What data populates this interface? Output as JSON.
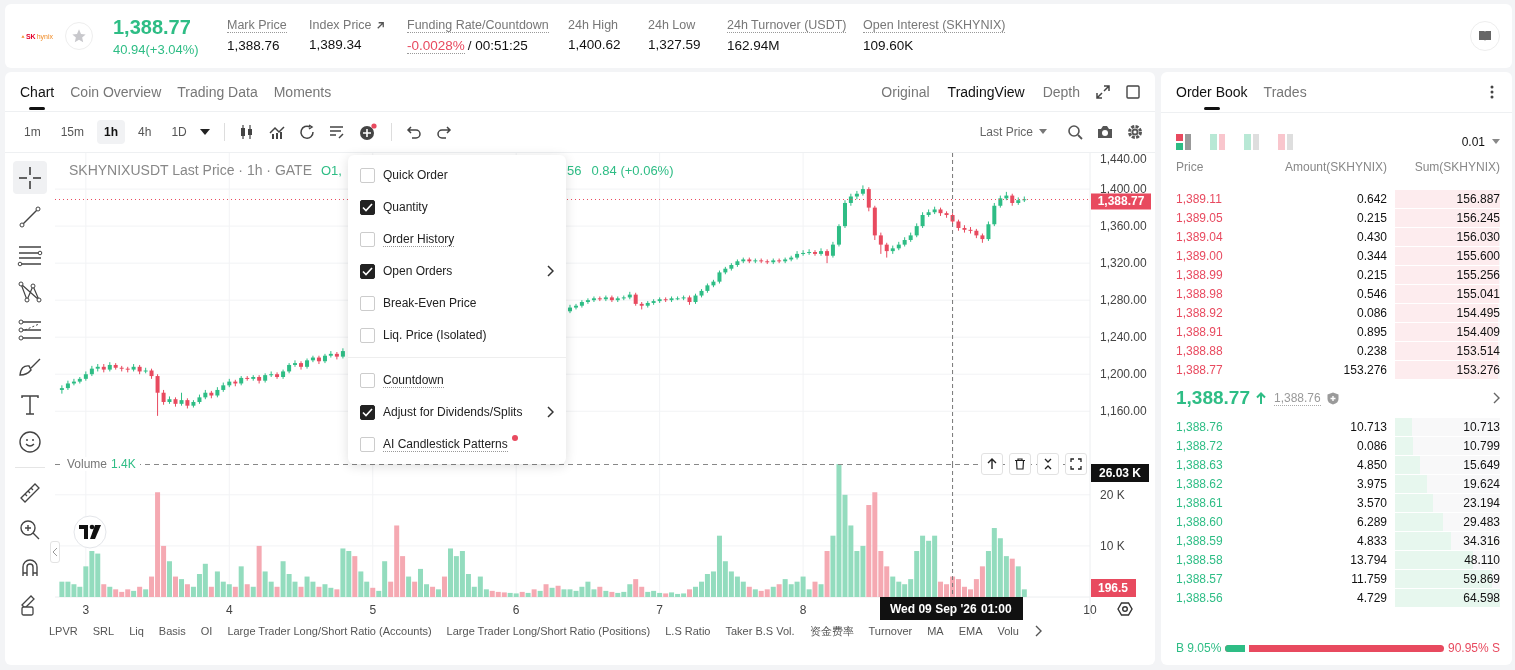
{
  "header": {
    "logo": [
      "SK",
      "hynix"
    ],
    "price": "1,388.77",
    "change": "40.94(+3.04%)",
    "stats": [
      {
        "kind": "plain",
        "label": "Mark Price",
        "value": "1,388.76",
        "underlined": true,
        "link": false
      },
      {
        "kind": "plain",
        "label": "Index Price",
        "value": "1,389.34",
        "underlined": false,
        "link": true
      },
      {
        "kind": "funding",
        "label": "Funding Rate/Countdown",
        "value": "-0.0028%",
        "extra": "/ 00:51:25",
        "underlined": true,
        "link": false
      },
      {
        "kind": "plain",
        "label": "24h High",
        "value": "1,400.62",
        "underlined": false,
        "link": false
      },
      {
        "kind": "plain",
        "label": "24h Low",
        "value": "1,327.59",
        "underlined": false,
        "link": false
      },
      {
        "kind": "plain",
        "label": "24h Turnover (USDT)",
        "value": "162.94M",
        "underlined": true,
        "link": false
      },
      {
        "kind": "plain",
        "label": "Open Interest (SKHYNIX)",
        "value": "109.60K",
        "underlined": true,
        "link": false
      }
    ]
  },
  "chart_panel": {
    "tabs": [
      {
        "label": "Chart",
        "selected": true
      },
      {
        "label": "Coin Overview",
        "selected": false
      },
      {
        "label": "Trading Data",
        "selected": false
      },
      {
        "label": "Moments",
        "selected": false
      }
    ],
    "views": [
      {
        "label": "Original",
        "selected": false
      },
      {
        "label": "TradingView",
        "selected": true
      },
      {
        "label": "Depth",
        "selected": false
      }
    ],
    "intervals": [
      {
        "label": "1m",
        "selected": false
      },
      {
        "label": "15m",
        "selected": false
      },
      {
        "label": "1h",
        "selected": true
      },
      {
        "label": "4h",
        "selected": false
      },
      {
        "label": "1D",
        "selected": false
      }
    ],
    "price_type": "Last Price",
    "legend": {
      "title": "SKHYNIXUSDT Last Price · 1h · GATE",
      "open": "O1,",
      "close_tail": "56",
      "change": "0.84 (+0.06%)"
    },
    "price_top_tick": "1,440.00",
    "price_chart": {
      "chart_data": {
        "type": "candlestick",
        "ylim": [
          1103,
          1439
        ],
        "xlim": [
          2.785,
          10
        ],
        "grid": true,
        "ref_lines": [
          {
            "axis": "y",
            "value": 1388.77
          },
          {
            "axis": "x",
            "value": 9.042
          }
        ],
        "x": [
          2.833,
          2.875,
          2.917,
          2.958,
          3,
          3.042,
          3.083,
          3.125,
          3.167,
          3.208,
          3.25,
          3.292,
          3.333,
          3.375,
          3.417,
          3.458,
          3.5,
          3.542,
          3.583,
          3.625,
          3.667,
          3.708,
          3.75,
          3.792,
          3.833,
          3.875,
          3.917,
          3.958,
          4,
          4.042,
          4.083,
          4.125,
          4.167,
          4.208,
          4.25,
          4.292,
          4.333,
          4.375,
          4.417,
          4.458,
          4.5,
          4.542,
          4.583,
          4.625,
          4.667,
          4.708,
          4.75,
          4.792,
          null,
          null,
          null,
          null,
          null,
          null,
          null,
          null,
          null,
          null,
          null,
          null,
          null,
          null,
          null,
          null,
          null,
          null,
          null,
          null,
          null,
          null,
          null,
          null,
          null,
          null,
          null,
          null,
          null,
          null,
          null,
          null,
          null,
          null,
          null,
          null,
          null,
          6.375,
          6.417,
          6.458,
          6.5,
          6.542,
          6.583,
          6.625,
          6.667,
          6.708,
          6.75,
          6.792,
          6.833,
          6.875,
          6.917,
          6.958,
          7,
          7.042,
          7.083,
          7.125,
          7.167,
          7.208,
          7.25,
          7.292,
          7.333,
          7.375,
          7.417,
          7.458,
          7.5,
          7.542,
          7.583,
          7.625,
          7.667,
          7.708,
          7.75,
          7.792,
          7.833,
          7.875,
          7.917,
          7.958,
          8,
          8.042,
          8.083,
          8.125,
          8.167,
          8.208,
          8.25,
          8.292,
          8.333,
          8.375,
          8.417,
          8.458,
          8.5,
          8.542,
          8.583,
          8.625,
          8.667,
          8.708,
          8.75,
          8.792,
          8.833,
          8.875,
          8.917,
          8.958,
          9,
          9.042,
          9.083,
          9.125,
          9.167,
          9.208,
          9.25,
          9.292,
          9.333,
          9.375,
          9.417,
          9.458,
          9.5,
          9.542
        ],
        "yticks": [
          {
            "value": 1400,
            "label": "1,400.00"
          },
          {
            "value": 1360,
            "label": "1,360.00"
          },
          {
            "value": 1320,
            "label": "1,320.00"
          },
          {
            "value": 1280,
            "label": "1,280.00"
          },
          {
            "value": 1240,
            "label": "1,240.00"
          },
          {
            "value": 1200,
            "label": "1,200.00"
          },
          {
            "value": 1160,
            "label": "1,160.00"
          }
        ],
        "ohlc": [
          [
            1183,
            1188,
            1179,
            1185
          ],
          [
            1185,
            1193,
            1183,
            1190
          ],
          [
            1190,
            1195,
            1188,
            1192
          ],
          [
            1192,
            1197,
            1190,
            1195
          ],
          [
            1195,
            1203,
            1193,
            1200
          ],
          [
            1200,
            1209,
            1198,
            1206
          ],
          [
            1206,
            1211,
            1203,
            1208
          ],
          [
            1208,
            1211,
            1202,
            1205
          ],
          [
            1205,
            1213,
            1203,
            1210
          ],
          [
            1210,
            1212,
            1205,
            1207
          ],
          [
            1207,
            1209,
            1203,
            1206
          ],
          [
            1206,
            1208,
            1202,
            1205
          ],
          [
            1205,
            1211,
            1203,
            1208
          ],
          [
            1208,
            1210,
            1200,
            1203
          ],
          [
            1203,
            1207,
            1201,
            1204
          ],
          [
            1204,
            1206,
            1195,
            1198
          ],
          [
            1198,
            1200,
            1155,
            1180
          ],
          [
            1180,
            1183,
            1167,
            1170
          ],
          [
            1170,
            1176,
            1168,
            1173
          ],
          [
            1173,
            1175,
            1165,
            1168
          ],
          [
            1168,
            1180,
            1166,
            1172
          ],
          [
            1172,
            1174,
            1163,
            1166
          ],
          [
            1166,
            1172,
            1164,
            1170
          ],
          [
            1170,
            1178,
            1168,
            1175
          ],
          [
            1175,
            1183,
            1173,
            1180
          ],
          [
            1180,
            1182,
            1174,
            1177
          ],
          [
            1177,
            1186,
            1175,
            1183
          ],
          [
            1183,
            1191,
            1181,
            1188
          ],
          [
            1188,
            1195,
            1186,
            1192
          ],
          [
            1192,
            1194,
            1187,
            1190
          ],
          [
            1190,
            1198,
            1188,
            1196
          ],
          [
            1196,
            1198,
            1193,
            1195
          ],
          [
            1195,
            1199,
            1193,
            1197
          ],
          [
            1197,
            1199,
            1190,
            1193
          ],
          [
            1193,
            1201,
            1191,
            1199
          ],
          [
            1199,
            1203,
            1197,
            1200
          ],
          [
            1200,
            1202,
            1195,
            1197
          ],
          [
            1197,
            1205,
            1195,
            1203
          ],
          [
            1203,
            1212,
            1201,
            1210
          ],
          [
            1210,
            1215,
            1208,
            1212
          ],
          [
            1212,
            1214,
            1205,
            1208
          ],
          [
            1208,
            1217,
            1206,
            1215
          ],
          [
            1215,
            1220,
            1213,
            1218
          ],
          [
            1218,
            1220,
            1211,
            1214
          ],
          [
            1214,
            1222,
            1212,
            1220
          ],
          [
            1220,
            1225,
            1218,
            1222
          ],
          [
            1222,
            1224,
            1216,
            1219
          ],
          [
            1219,
            1228,
            1217,
            1225
          ],
          null,
          null,
          null,
          null,
          null,
          null,
          null,
          null,
          null,
          null,
          null,
          null,
          null,
          null,
          null,
          null,
          null,
          null,
          null,
          null,
          null,
          null,
          null,
          null,
          null,
          null,
          null,
          null,
          null,
          null,
          null,
          null,
          null,
          null,
          null,
          null,
          null,
          [
            1268,
            1275,
            1266,
            1272
          ],
          [
            1272,
            1276,
            1270,
            1274
          ],
          [
            1274,
            1280,
            1272,
            1278
          ],
          [
            1278,
            1282,
            1276,
            1280
          ],
          [
            1280,
            1284,
            1278,
            1282
          ],
          [
            1282,
            1284,
            1279,
            1281
          ],
          [
            1281,
            1285,
            1279,
            1283
          ],
          [
            1283,
            1285,
            1278,
            1280
          ],
          [
            1280,
            1284,
            1278,
            1282
          ],
          [
            1282,
            1285,
            1280,
            1283
          ],
          [
            1283,
            1289,
            1281,
            1286
          ],
          [
            1286,
            1288,
            1274,
            1276
          ],
          [
            1276,
            1278,
            1270,
            1274
          ],
          [
            1274,
            1279,
            1272,
            1277
          ],
          [
            1277,
            1281,
            1275,
            1279
          ],
          [
            1279,
            1283,
            1277,
            1281
          ],
          [
            1281,
            1283,
            1278,
            1280
          ],
          [
            1280,
            1284,
            1278,
            1282
          ],
          [
            1282,
            1284,
            1280,
            1282
          ],
          [
            1282,
            1285,
            1280,
            1283
          ],
          [
            1283,
            1285,
            1275,
            1278
          ],
          [
            1278,
            1287,
            1276,
            1285
          ],
          [
            1285,
            1292,
            1283,
            1290
          ],
          [
            1290,
            1298,
            1288,
            1296
          ],
          [
            1296,
            1302,
            1294,
            1300
          ],
          [
            1300,
            1312,
            1298,
            1310
          ],
          [
            1310,
            1316,
            1308,
            1314
          ],
          [
            1314,
            1320,
            1312,
            1318
          ],
          [
            1318,
            1324,
            1316,
            1322
          ],
          [
            1322,
            1326,
            1320,
            1324
          ],
          [
            1324,
            1326,
            1320,
            1322
          ],
          [
            1322,
            1325,
            1320,
            1323
          ],
          [
            1323,
            1325,
            1320,
            1322
          ],
          [
            1322,
            1324,
            1319,
            1321
          ],
          [
            1321,
            1325,
            1319,
            1323
          ],
          [
            1323,
            1325,
            1320,
            1322
          ],
          [
            1322,
            1326,
            1320,
            1324
          ],
          [
            1324,
            1328,
            1322,
            1326
          ],
          [
            1326,
            1333,
            1324,
            1330
          ],
          [
            1330,
            1334,
            1328,
            1331
          ],
          [
            1331,
            1335,
            1329,
            1332
          ],
          [
            1332,
            1334,
            1328,
            1330
          ],
          [
            1330,
            1336,
            1328,
            1333
          ],
          [
            1333,
            1335,
            1320,
            1328
          ],
          [
            1328,
            1343,
            1326,
            1340
          ],
          [
            1340,
            1362,
            1338,
            1360
          ],
          [
            1360,
            1388,
            1358,
            1385
          ],
          [
            1385,
            1395,
            1382,
            1392
          ],
          [
            1392,
            1398,
            1389,
            1395
          ],
          [
            1395,
            1404,
            1393,
            1400
          ],
          [
            1400,
            1402,
            1376,
            1380
          ],
          [
            1380,
            1382,
            1345,
            1350
          ],
          [
            1350,
            1353,
            1330,
            1340
          ],
          [
            1340,
            1342,
            1326,
            1333
          ],
          [
            1333,
            1339,
            1330,
            1336
          ],
          [
            1336,
            1343,
            1334,
            1340
          ],
          [
            1340,
            1348,
            1338,
            1345
          ],
          [
            1345,
            1353,
            1343,
            1350
          ],
          [
            1350,
            1363,
            1348,
            1360
          ],
          [
            1360,
            1375,
            1358,
            1372
          ],
          [
            1372,
            1378,
            1370,
            1375
          ],
          [
            1375,
            1381,
            1373,
            1378
          ],
          [
            1378,
            1380,
            1371,
            1374
          ],
          [
            1374,
            1376,
            1369,
            1372
          ],
          [
            1372,
            1374,
            1362,
            1365
          ],
          [
            1365,
            1367,
            1355,
            1358
          ],
          [
            1358,
            1361,
            1353,
            1356
          ],
          [
            1356,
            1359,
            1352,
            1355
          ],
          [
            1355,
            1357,
            1347,
            1350
          ],
          [
            1350,
            1352,
            1342,
            1346
          ],
          [
            1346,
            1365,
            1344,
            1362
          ],
          [
            1362,
            1385,
            1360,
            1382
          ],
          [
            1382,
            1393,
            1380,
            1390
          ],
          [
            1390,
            1397,
            1388,
            1393
          ],
          [
            1393,
            1395,
            1382,
            1385
          ],
          [
            1385,
            1391,
            1383,
            1388
          ],
          [
            1388,
            1392,
            1386,
            1389
          ]
        ]
      }
    },
    "last_price_badge": "1,388.77",
    "volume": {
      "value": "1.4K",
      "rising": [
        true,
        true,
        true,
        true,
        true,
        true,
        true,
        false,
        true,
        false,
        false,
        false,
        true,
        false,
        true,
        false,
        false,
        false,
        true,
        false,
        true,
        false,
        true,
        true,
        true,
        false,
        true,
        true,
        true,
        false,
        true,
        false,
        true,
        false,
        true,
        true,
        false,
        true,
        true,
        true,
        false,
        true,
        true,
        false,
        true,
        true,
        false,
        true,
        true,
        false,
        true,
        true,
        false,
        true,
        true,
        false,
        false,
        false,
        true,
        false,
        true,
        true,
        false,
        true,
        false,
        true,
        true,
        true,
        true,
        true,
        true,
        true,
        false,
        false,
        false,
        true,
        true,
        false,
        true,
        false,
        true,
        false,
        true,
        false,
        true,
        true,
        true,
        true,
        true,
        true,
        false,
        true,
        false,
        true,
        true,
        true,
        false,
        false,
        true,
        true,
        true,
        false,
        true,
        true,
        true,
        false,
        true,
        true,
        true,
        true,
        true,
        true,
        true,
        true,
        true,
        false,
        true,
        false,
        false,
        true,
        false,
        true,
        true,
        true,
        true,
        true,
        false,
        true,
        false,
        true,
        true,
        true,
        true,
        true,
        true,
        false,
        false,
        false,
        false,
        true,
        true,
        true,
        true,
        true,
        true,
        true,
        true,
        false,
        false,
        false,
        false,
        false,
        false,
        false,
        false,
        true,
        true,
        true,
        true,
        false,
        true,
        true
      ],
      "cursor_badge": "26.03 K",
      "last_badge": "196.5",
      "chart_data": {
        "type": "bar",
        "ylim": [
          0,
          26030
        ],
        "xlim": [
          2.785,
          10
        ],
        "grid": true,
        "ref_lines": [
          {
            "axis": "x",
            "value": 9.042
          },
          {
            "axis": "y",
            "value": 26030
          }
        ],
        "x": [
          2.833,
          2.875,
          2.917,
          2.958,
          3,
          3.042,
          3.083,
          3.125,
          3.167,
          3.208,
          3.25,
          3.292,
          3.333,
          3.375,
          3.417,
          3.458,
          3.5,
          3.542,
          3.583,
          3.625,
          3.667,
          3.708,
          3.75,
          3.792,
          3.833,
          3.875,
          3.917,
          3.958,
          4,
          4.042,
          4.083,
          4.125,
          4.167,
          4.208,
          4.25,
          4.292,
          4.333,
          4.375,
          4.417,
          4.458,
          4.5,
          4.542,
          4.583,
          4.625,
          4.667,
          4.708,
          4.75,
          4.792,
          4.833,
          4.875,
          4.917,
          4.958,
          5,
          5.042,
          5.083,
          5.125,
          5.167,
          5.208,
          5.25,
          5.292,
          5.333,
          5.375,
          5.417,
          5.458,
          5.5,
          5.542,
          5.583,
          5.625,
          5.667,
          5.708,
          5.75,
          5.792,
          5.833,
          5.875,
          5.917,
          5.958,
          6,
          6.042,
          6.083,
          6.125,
          6.167,
          6.208,
          6.25,
          6.292,
          6.333,
          6.375,
          6.417,
          6.458,
          6.5,
          6.542,
          6.583,
          6.625,
          6.667,
          6.708,
          6.75,
          6.792,
          6.833,
          6.875,
          6.917,
          6.958,
          7,
          7.042,
          7.083,
          7.125,
          7.167,
          7.208,
          7.25,
          7.292,
          7.333,
          7.375,
          7.417,
          7.458,
          7.5,
          7.542,
          7.583,
          7.625,
          7.667,
          7.708,
          7.75,
          7.792,
          7.833,
          7.875,
          7.917,
          7.958,
          8,
          8.042,
          8.083,
          8.125,
          8.167,
          8.208,
          8.25,
          8.292,
          8.333,
          8.375,
          8.417,
          8.458,
          8.5,
          8.542,
          8.583,
          8.625,
          8.667,
          8.708,
          8.75,
          8.792,
          8.833,
          8.875,
          8.917,
          8.958,
          9,
          9.042,
          9.083,
          9.125,
          9.167,
          9.208,
          9.25,
          9.292,
          9.333,
          9.375,
          9.417,
          9.458,
          9.5,
          9.542
        ],
        "xticks": [
          {
            "value": 3,
            "label": "3"
          },
          {
            "value": 4,
            "label": "4"
          },
          {
            "value": 5,
            "label": "5"
          },
          {
            "value": 6,
            "label": "6"
          },
          {
            "value": 7,
            "label": "7"
          },
          {
            "value": 8,
            "label": "8"
          },
          {
            "value": 10,
            "label": "10"
          }
        ],
        "yticks": [
          {
            "value": 20000,
            "label": "20 K"
          },
          {
            "value": 10000,
            "label": "10 K"
          }
        ],
        "series": [
          {
            "name": "Volume",
            "values": [
              3000,
              3000,
              2500,
              2000,
              6000,
              9000,
              8500,
              2500,
              2000,
              1500,
              1000,
              1500,
              1200,
              2000,
              1500,
              4000,
              20500,
              10000,
              7000,
              4000,
              3500,
              2500,
              2000,
              4500,
              6500,
              2000,
              5000,
              3000,
              2500,
              2000,
              6000,
              2500,
              2000,
              10000,
              5000,
              3000,
              2000,
              7000,
              4500,
              3000,
              2000,
              4000,
              3000,
              2000,
              2500,
              1800,
              1500,
              9500,
              9000,
              8000,
              5000,
              3000,
              1800,
              1200,
              7000,
              3000,
              14000,
              8000,
              4000,
              3000,
              5500,
              2500,
              2000,
              1500,
              4000,
              9500,
              8000,
              9000,
              4500,
              2000,
              4000,
              1500,
              1200,
              1000,
              900,
              800,
              700,
              1000,
              800,
              1500,
              1200,
              2500,
              1800,
              2200,
              1500,
              1500,
              1200,
              2000,
              3000,
              1500,
              2000,
              1200,
              1000,
              800,
              1000,
              2500,
              3500,
              2000,
              1000,
              1200,
              800,
              700,
              900,
              600,
              700,
              1500,
              2000,
              3000,
              4500,
              5000,
              12000,
              7000,
              5000,
              4000,
              3000,
              2000,
              1500,
              1200,
              1500,
              2000,
              2500,
              3500,
              2500,
              3000,
              4000,
              1500,
              3000,
              2500,
              9000,
              12000,
              26030,
              20000,
              14000,
              9000,
              10000,
              18000,
              20500,
              9000,
              6000,
              4000,
              3000,
              2500,
              3500,
              9000,
              12000,
              11000,
              12000,
              3000,
              2500,
              4000,
              3500,
              2000,
              1500,
              3500,
              6000,
              9000,
              13500,
              11500,
              8000,
              7500,
              6000,
              1500
            ]
          }
        ]
      }
    },
    "crosshair": {
      "date": "Wed 09 Sep '26",
      "time": "01:00"
    },
    "indicators": [
      "LPVR",
      "SRL",
      "Liq",
      "Basis",
      "OI",
      "Large Trader Long/Short Ratio (Accounts)",
      "Large Trader Long/Short Ratio (Positions)",
      "L.S Ratio",
      "Taker B.S Vol.",
      "资金费率",
      "Turnover",
      "MA",
      "EMA",
      "Volu"
    ],
    "menu": {
      "groups": [
        [
          {
            "label": "Quick Order",
            "checked": false,
            "tooltip": false,
            "submenu": false,
            "new": false
          },
          {
            "label": "Quantity",
            "checked": true,
            "tooltip": false,
            "submenu": false,
            "new": false
          },
          {
            "label": "Order History",
            "checked": false,
            "tooltip": true,
            "submenu": false,
            "new": false
          },
          {
            "label": "Open Orders",
            "checked": true,
            "tooltip": false,
            "submenu": true,
            "new": false
          },
          {
            "label": "Break-Even Price",
            "checked": false,
            "tooltip": false,
            "submenu": false,
            "new": false
          },
          {
            "label": "Liq. Price (Isolated)",
            "checked": false,
            "tooltip": false,
            "submenu": false,
            "new": false
          }
        ],
        [
          {
            "label": "Countdown",
            "checked": false,
            "tooltip": true,
            "submenu": false,
            "new": false
          },
          {
            "label": "Adjust for Dividends/Splits",
            "checked": true,
            "tooltip": false,
            "submenu": true,
            "new": false
          },
          {
            "label": "AI Candlestick Patterns",
            "checked": false,
            "tooltip": true,
            "submenu": false,
            "new": true
          }
        ]
      ]
    }
  },
  "order_book": {
    "tabs": [
      {
        "label": "Order Book",
        "selected": true
      },
      {
        "label": "Trades",
        "selected": false
      }
    ],
    "layouts": [
      {
        "kind": "both",
        "selected": true
      },
      {
        "kind": "bids",
        "selected": false
      },
      {
        "kind": "bids-only",
        "selected": false
      },
      {
        "kind": "asks",
        "selected": false
      }
    ],
    "precision": "0.01",
    "columns": [
      "Price",
      "Amount(SKHYNIX)",
      "Sum(SKHYNIX)"
    ],
    "asks": [
      {
        "price": "1,389.11",
        "amount": "0.642",
        "sum": "156.887",
        "level": 1
      },
      {
        "price": "1,389.05",
        "amount": "0.215",
        "sum": "156.245",
        "level": 0.996
      },
      {
        "price": "1,389.04",
        "amount": "0.430",
        "sum": "156.030",
        "level": 0.995
      },
      {
        "price": "1,389.00",
        "amount": "0.344",
        "sum": "155.600",
        "level": 0.992
      },
      {
        "price": "1,388.99",
        "amount": "0.215",
        "sum": "155.256",
        "level": 0.99
      },
      {
        "price": "1,388.98",
        "amount": "0.546",
        "sum": "155.041",
        "level": 0.988
      },
      {
        "price": "1,388.92",
        "amount": "0.086",
        "sum": "154.495",
        "level": 0.985
      },
      {
        "price": "1,388.91",
        "amount": "0.895",
        "sum": "154.409",
        "level": 0.984
      },
      {
        "price": "1,388.88",
        "amount": "0.238",
        "sum": "153.514",
        "level": 0.979
      },
      {
        "price": "1,388.77",
        "amount": "153.276",
        "sum": "153.276",
        "level": 0.977
      }
    ],
    "last_price": "1,388.77",
    "mark_price": "1,388.76",
    "bids": [
      {
        "price": "1,388.76",
        "amount": "10.713",
        "sum": "10.713",
        "level": 0.166
      },
      {
        "price": "1,388.72",
        "amount": "0.086",
        "sum": "10.799",
        "level": 0.167
      },
      {
        "price": "1,388.63",
        "amount": "4.850",
        "sum": "15.649",
        "level": 0.242
      },
      {
        "price": "1,388.62",
        "amount": "3.975",
        "sum": "19.624",
        "level": 0.304
      },
      {
        "price": "1,388.61",
        "amount": "3.570",
        "sum": "23.194",
        "level": 0.359
      },
      {
        "price": "1,388.60",
        "amount": "6.289",
        "sum": "29.483",
        "level": 0.456
      },
      {
        "price": "1,388.59",
        "amount": "4.833",
        "sum": "34.316",
        "level": 0.531
      },
      {
        "price": "1,388.58",
        "amount": "13.794",
        "sum": "48.110",
        "level": 0.745
      },
      {
        "price": "1,388.57",
        "amount": "11.759",
        "sum": "59.869",
        "level": 0.927
      },
      {
        "price": "1,388.56",
        "amount": "4.729",
        "sum": "64.598",
        "level": 1
      }
    ],
    "ratio": {
      "buy": "B 9.05%",
      "sell": "90.95% S",
      "level": 0.0905
    }
  }
}
